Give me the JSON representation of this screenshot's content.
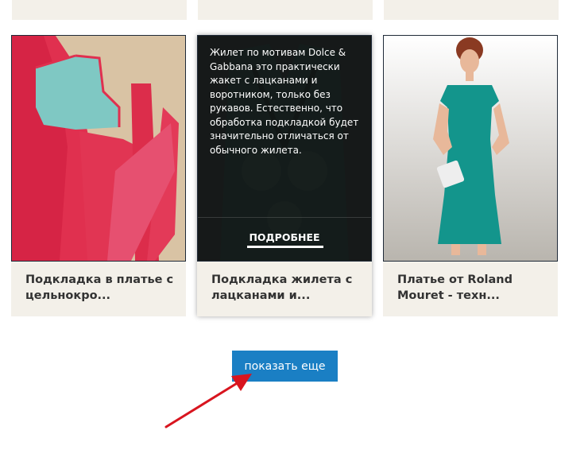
{
  "cards": [
    {
      "title": "Подкладка в платье с цельнокро...",
      "image": "red-fabric-pattern-pieces"
    },
    {
      "title": "Подкладка жилета с лацканами и...",
      "image": "dark-brocade-vest",
      "overlay_text": "Жилет по мотивам Dolce & Gabbana это практически жакет с лацканами и воротником, только без рукавов. Естественно, что обработка подкладкой будет значительно отличаться от обычного жилета.",
      "more_label": "ПОДРОБНЕЕ"
    },
    {
      "title": "Платье от Roland Mouret - техн...",
      "image": "woman-in-teal-dress"
    }
  ],
  "show_more_label": "показать еще",
  "colors": {
    "card_bg": "#f3f0e9",
    "button": "#1a7fc4",
    "arrow": "#d8151f"
  }
}
